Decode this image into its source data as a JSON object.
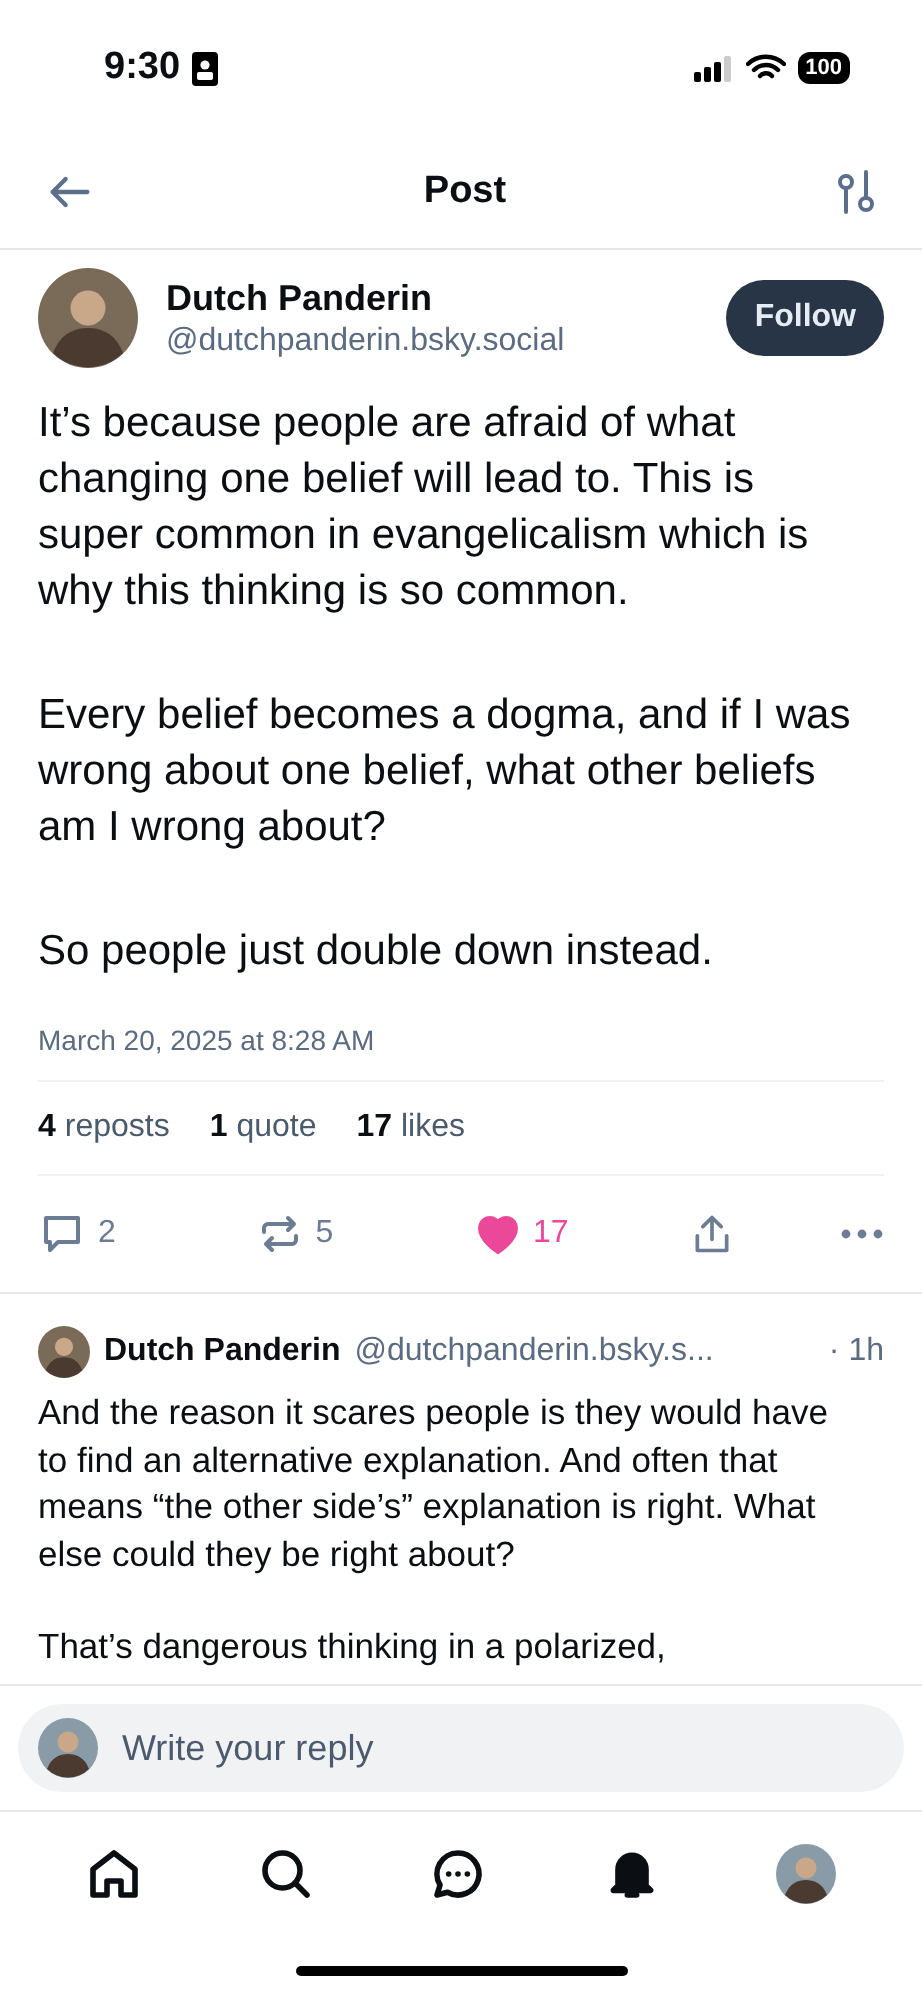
{
  "status_bar": {
    "time": "9:30",
    "battery": "100"
  },
  "header": {
    "title": "Post"
  },
  "post": {
    "author": {
      "name": "Dutch Panderin",
      "handle": "@dutchpanderin.bsky.social"
    },
    "follow_button": "Follow",
    "paragraphs": [
      "It’s because people are afraid of what changing one belief will lead to. This is super common in evangelicalism which is why this thinking is so common.",
      "Every belief becomes a dogma, and if I was wrong about one belief, what other beliefs am I wrong about?",
      "So people just double down instead."
    ],
    "timestamp": "March 20, 2025 at 8:28 AM",
    "stats": [
      {
        "count": "4",
        "label": "reposts"
      },
      {
        "count": "1",
        "label": "quote"
      },
      {
        "count": "17",
        "label": "likes"
      }
    ],
    "actions": [
      {
        "kind": "reply",
        "count": "2",
        "on": false
      },
      {
        "kind": "repost",
        "count": "5",
        "on": false
      },
      {
        "kind": "like",
        "count": "17",
        "on": true
      },
      {
        "kind": "share"
      },
      {
        "kind": "more"
      }
    ]
  },
  "reply": {
    "author": {
      "name": "Dutch Panderin",
      "handle": "@dutchpanderin.bsky.s..."
    },
    "time": "· 1h",
    "paragraphs": [
      "And the reason it scares people is they would have to find an alternative explanation. And often that means “the other side’s” explanation is right. What else could they be right about?",
      "That’s dangerous thinking in a polarized,"
    ]
  },
  "composer": {
    "placeholder": "Write your reply"
  },
  "nav": [
    {
      "kind": "home"
    },
    {
      "kind": "search"
    },
    {
      "kind": "chat"
    },
    {
      "kind": "notifications"
    },
    {
      "kind": "profile"
    }
  ]
}
